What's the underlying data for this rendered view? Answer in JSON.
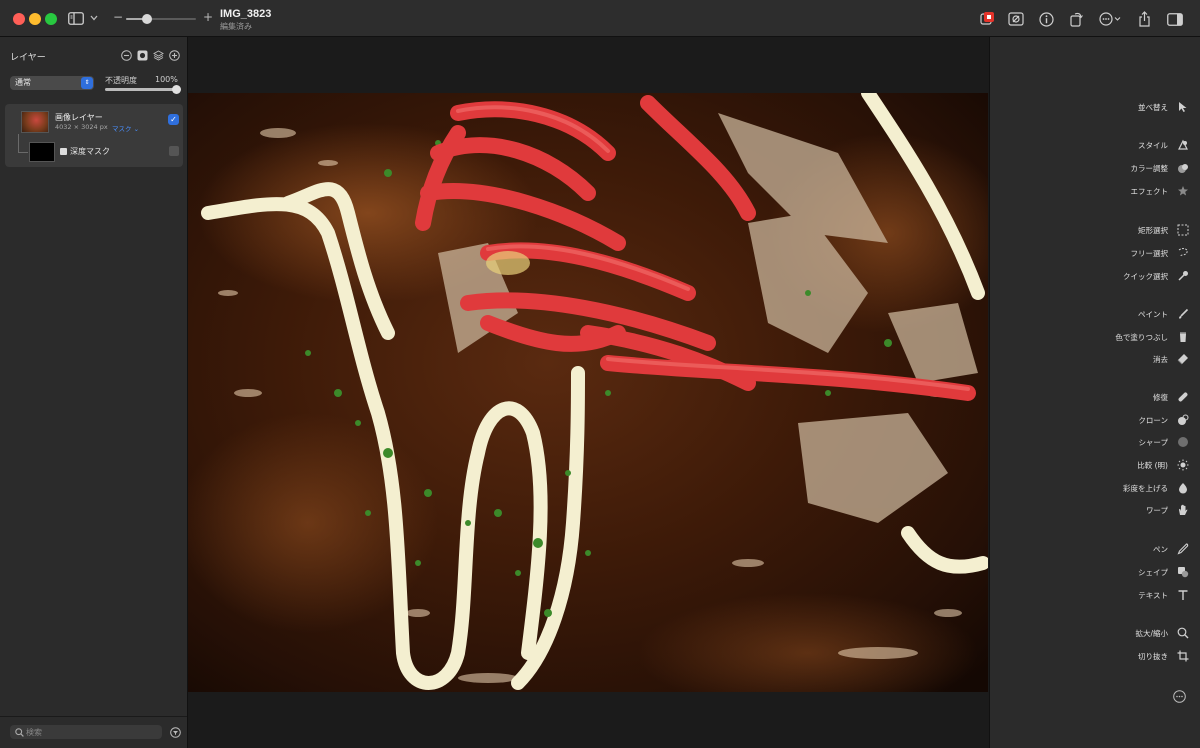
{
  "window": {
    "title": "IMG_3823",
    "subtitle": "編集済み",
    "zoom_minus": "−",
    "zoom_plus": "+",
    "zoom_level": 0.3
  },
  "layers_panel": {
    "title": "レイヤー",
    "blend_mode": "通常",
    "opacity_label": "不透明度",
    "opacity_value": "100%",
    "layers": [
      {
        "name": "画像レイヤー",
        "dimensions": "4032 × 3024 px",
        "mask_label": "マスク ⌄",
        "visible": true
      }
    ],
    "mask": {
      "name": "深度マスク",
      "enabled": false
    },
    "search_placeholder": "検索"
  },
  "tools": [
    {
      "label": "並べ替え",
      "icon": "arrow-cursor-icon"
    },
    {
      "label": "スタイル",
      "icon": "style-brush-icon"
    },
    {
      "label": "カラー調整",
      "icon": "color-adjust-icon"
    },
    {
      "label": "エフェクト",
      "icon": "effects-star-icon"
    },
    {
      "label": "矩形選択",
      "icon": "rect-select-icon"
    },
    {
      "label": "フリー選択",
      "icon": "lasso-select-icon"
    },
    {
      "label": "クイック選択",
      "icon": "quick-select-icon"
    },
    {
      "label": "ペイント",
      "icon": "paint-brush-icon"
    },
    {
      "label": "色で塗りつぶし",
      "icon": "paint-bucket-icon"
    },
    {
      "label": "消去",
      "icon": "eraser-icon"
    },
    {
      "label": "修復",
      "icon": "bandage-icon"
    },
    {
      "label": "クローン",
      "icon": "clone-stamp-icon"
    },
    {
      "label": "シャープ",
      "icon": "sharpen-icon"
    },
    {
      "label": "比較 (明)",
      "icon": "sun-icon"
    },
    {
      "label": "彩度を上げる",
      "icon": "saturate-icon"
    },
    {
      "label": "ワープ",
      "icon": "warp-hand-icon"
    },
    {
      "label": "ペン",
      "icon": "pen-nib-icon"
    },
    {
      "label": "シェイプ",
      "icon": "shapes-icon"
    },
    {
      "label": "テキスト",
      "icon": "text-tool-icon"
    },
    {
      "label": "拡大/縮小",
      "icon": "magnifier-icon"
    },
    {
      "label": "切り抜き",
      "icon": "crop-icon"
    }
  ],
  "colors": {
    "accent": "#2f6fdd",
    "panel": "#2b2b2b",
    "titlebar": "#2d2d2d",
    "history_red": "#e5332a"
  }
}
